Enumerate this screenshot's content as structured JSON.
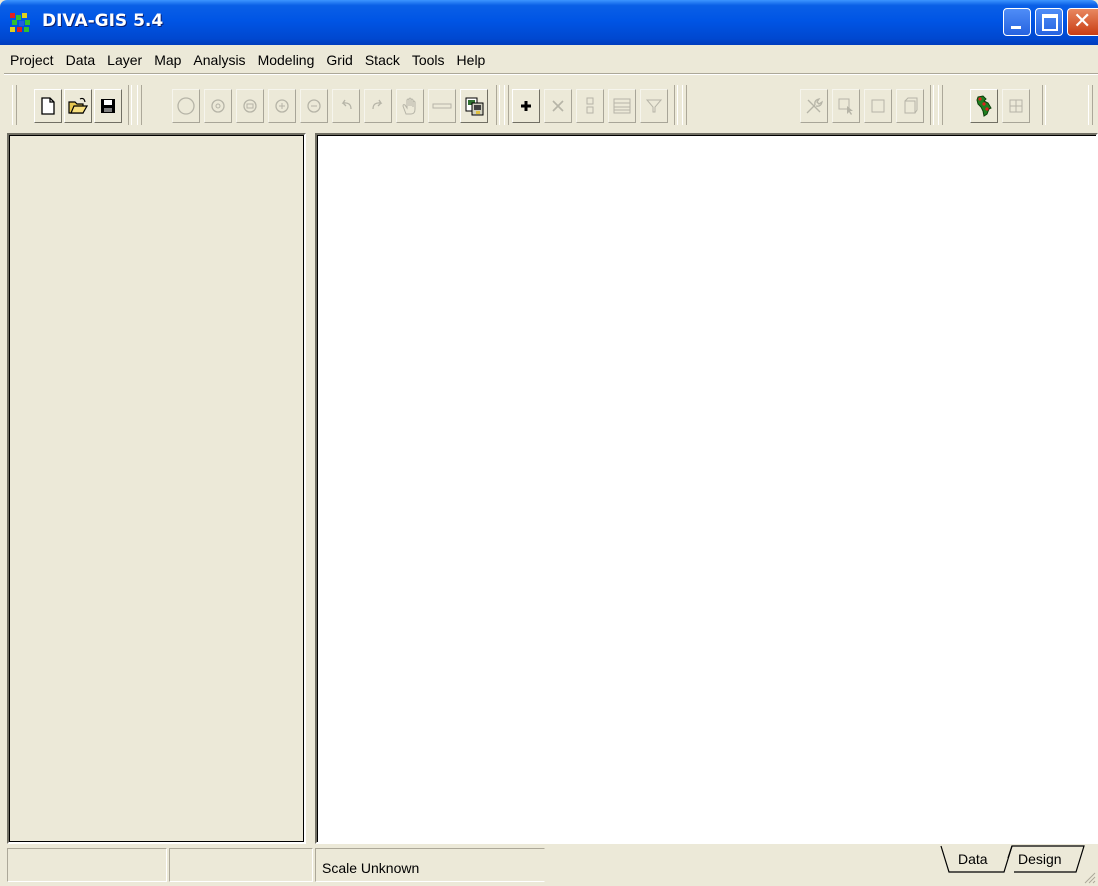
{
  "window": {
    "title": "DIVA-GIS 5.4"
  },
  "menu": [
    {
      "label": "Project"
    },
    {
      "label": "Data"
    },
    {
      "label": "Layer"
    },
    {
      "label": "Map"
    },
    {
      "label": "Analysis"
    },
    {
      "label": "Modeling"
    },
    {
      "label": "Grid"
    },
    {
      "label": "Stack"
    },
    {
      "label": "Tools"
    },
    {
      "label": "Help"
    }
  ],
  "toolbar": {
    "icons": [
      "new-project-icon",
      "open-project-icon",
      "save-project-icon",
      "full-extent-icon",
      "zoom-layer-icon",
      "zoom-selection-icon",
      "zoom-in-icon",
      "zoom-out-icon",
      "previous-extent-icon",
      "next-extent-icon",
      "pan-icon",
      "measure-icon",
      "copy-map-icon",
      "add-layer-icon",
      "remove-layer-icon",
      "legend-icon",
      "attribute-table-icon",
      "query-icon",
      "tools-icon",
      "select-icon",
      "rectangle-select-icon",
      "clear-selection-icon",
      "diva-map-icon",
      "grid-icon"
    ]
  },
  "status": {
    "scale": "Scale Unknown"
  },
  "tabs": [
    {
      "label": "Data",
      "active": true
    },
    {
      "label": "Design",
      "active": false
    }
  ],
  "colors": {
    "titlebar": "#0055e5",
    "chrome": "#ece9d8",
    "map_background": "#ffffff"
  }
}
